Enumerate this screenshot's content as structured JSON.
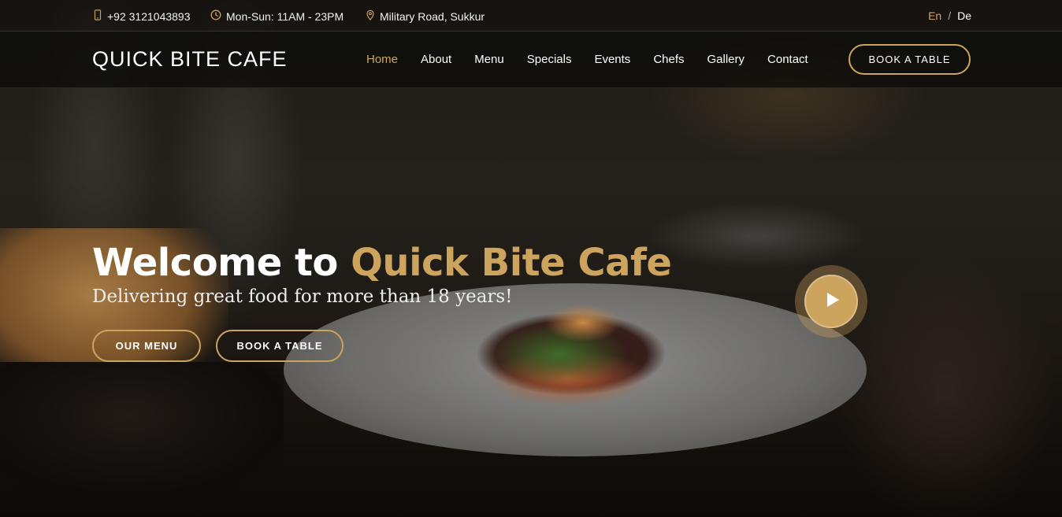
{
  "topbar": {
    "phone": "+92 3121043893",
    "hours": "Mon-Sun: 11AM - 23PM",
    "address": "Military Road, Sukkur",
    "lang_active": "En",
    "lang_sep": "/",
    "lang_other": "De"
  },
  "header": {
    "logo": "QUICK BITE CAFE",
    "nav": [
      "Home",
      "About",
      "Menu",
      "Specials",
      "Events",
      "Chefs",
      "Gallery",
      "Contact"
    ],
    "book_button": "BOOK A TABLE"
  },
  "hero": {
    "title_prefix": "Welcome to ",
    "title_accent": "Quick Bite Cafe",
    "subtitle": "Delivering great food for more than 18 years!",
    "menu_button": "OUR MENU",
    "book_button": "BOOK A TABLE"
  },
  "icons": {
    "phone": "phone-icon",
    "clock": "clock-icon",
    "location": "map-pin-icon",
    "play": "play-icon"
  },
  "colors": {
    "accent": "#cda45e",
    "header_bg": "#0c0b09"
  }
}
